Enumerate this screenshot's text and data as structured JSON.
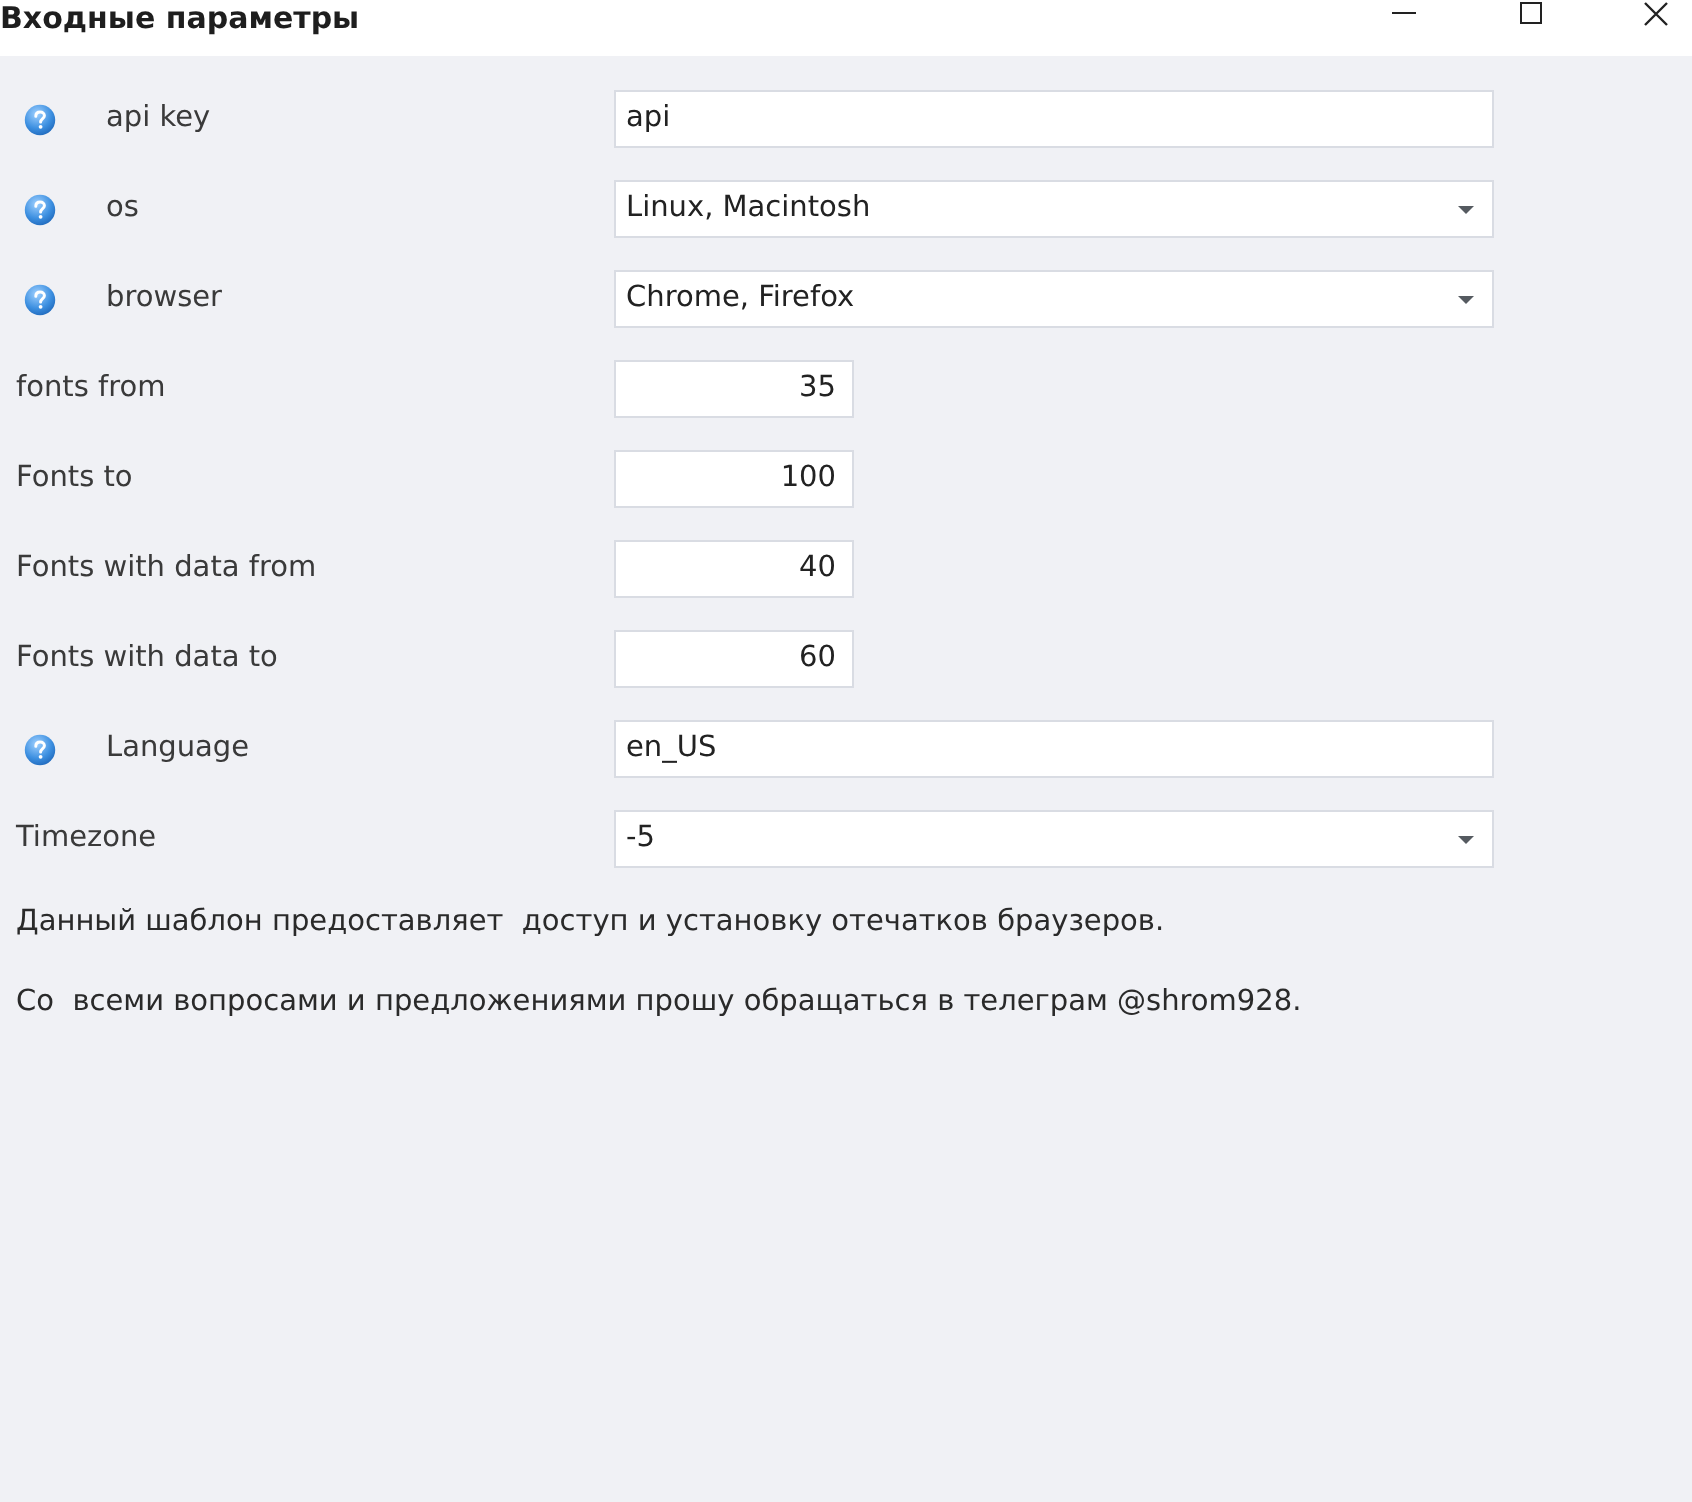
{
  "window": {
    "title": "Входные параметры"
  },
  "fields": [
    {
      "label": "api key",
      "help": true,
      "kind": "text",
      "value": "api"
    },
    {
      "label": "os",
      "help": true,
      "kind": "dropdown",
      "value": "Linux, Macintosh"
    },
    {
      "label": "browser",
      "help": true,
      "kind": "dropdown",
      "value": "Chrome, Firefox"
    },
    {
      "label": "fonts from",
      "help": false,
      "kind": "number",
      "value": "35"
    },
    {
      "label": "Fonts to",
      "help": false,
      "kind": "number",
      "value": "100"
    },
    {
      "label": "Fonts with data from",
      "help": false,
      "kind": "number",
      "value": "40"
    },
    {
      "label": "Fonts with data to",
      "help": false,
      "kind": "number",
      "value": "60"
    },
    {
      "label": "Language",
      "help": true,
      "kind": "text",
      "value": "en_US"
    },
    {
      "label": "Timezone",
      "help": false,
      "kind": "dropdown",
      "value": "-5"
    }
  ],
  "notes": [
    "Данный шаблон предоставляет  доступ и установку отечатков браузеров.",
    "Со  всеми вопросами и предложениями прошу обращаться в телеграм @shrom928."
  ]
}
